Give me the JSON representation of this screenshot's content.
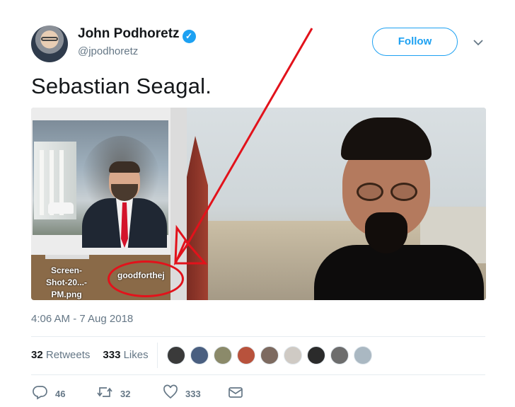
{
  "author": {
    "name": "John Podhoretz",
    "handle": "@jpodhoretz",
    "verified_glyph": "✓"
  },
  "follow_label": "Follow",
  "tweet_text": "Sebastian Seagal.",
  "media": {
    "file1_label_line1": "Screen-",
    "file1_label_line2": "Shot-20...-PM.png",
    "file2_label": "goodforthej"
  },
  "timestamp": "4:06 AM - 7 Aug 2018",
  "stats": {
    "retweets_count": "32",
    "retweets_label": "Retweets",
    "likes_count": "333",
    "likes_label": "Likes"
  },
  "likers_avatar_colors": [
    "#3a3a3a",
    "#4a5f80",
    "#8b8a6a",
    "#b8523c",
    "#7d6a60",
    "#cfcac4",
    "#2b2b2b",
    "#6d6d6d",
    "#aab8c2"
  ],
  "actions": {
    "reply_count": "46",
    "retweet_count": "32",
    "like_count": "333"
  },
  "icons": {
    "caret": "chevron-down-icon",
    "reply": "reply-icon",
    "retweet": "retweet-icon",
    "like": "heart-icon",
    "dm": "envelope-icon"
  },
  "colors": {
    "brand": "#1da1f2",
    "muted": "#657786",
    "annotation_red": "#e2121b"
  }
}
